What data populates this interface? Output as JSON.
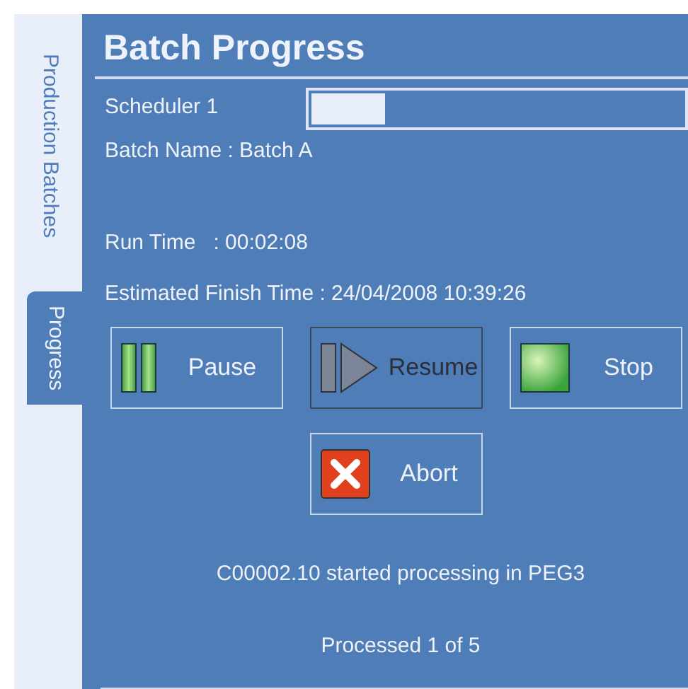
{
  "tabs": [
    {
      "label": "Production Batches",
      "selected": false
    },
    {
      "label": "Progress",
      "selected": true
    }
  ],
  "title": "Batch Progress",
  "scheduler": {
    "label": "Scheduler 1",
    "level": 0.2
  },
  "batch_name": "Batch Name : Batch A",
  "run_time": "Run Time   : 00:02:08",
  "estimated_finish": "Estimated Finish Time : 24/04/2008 10:39:26",
  "buttons": [
    {
      "kind": "pause",
      "label": "Pause",
      "disabled": false
    },
    {
      "kind": "resume",
      "label": "Resume",
      "disabled": true
    },
    {
      "kind": "stop",
      "label": "Stop",
      "disabled": false
    },
    {
      "kind": "abort",
      "label": "Abort",
      "disabled": false
    }
  ],
  "status": "C00002.10 started processing in PEG3",
  "processed": "Processed 1 of 5"
}
